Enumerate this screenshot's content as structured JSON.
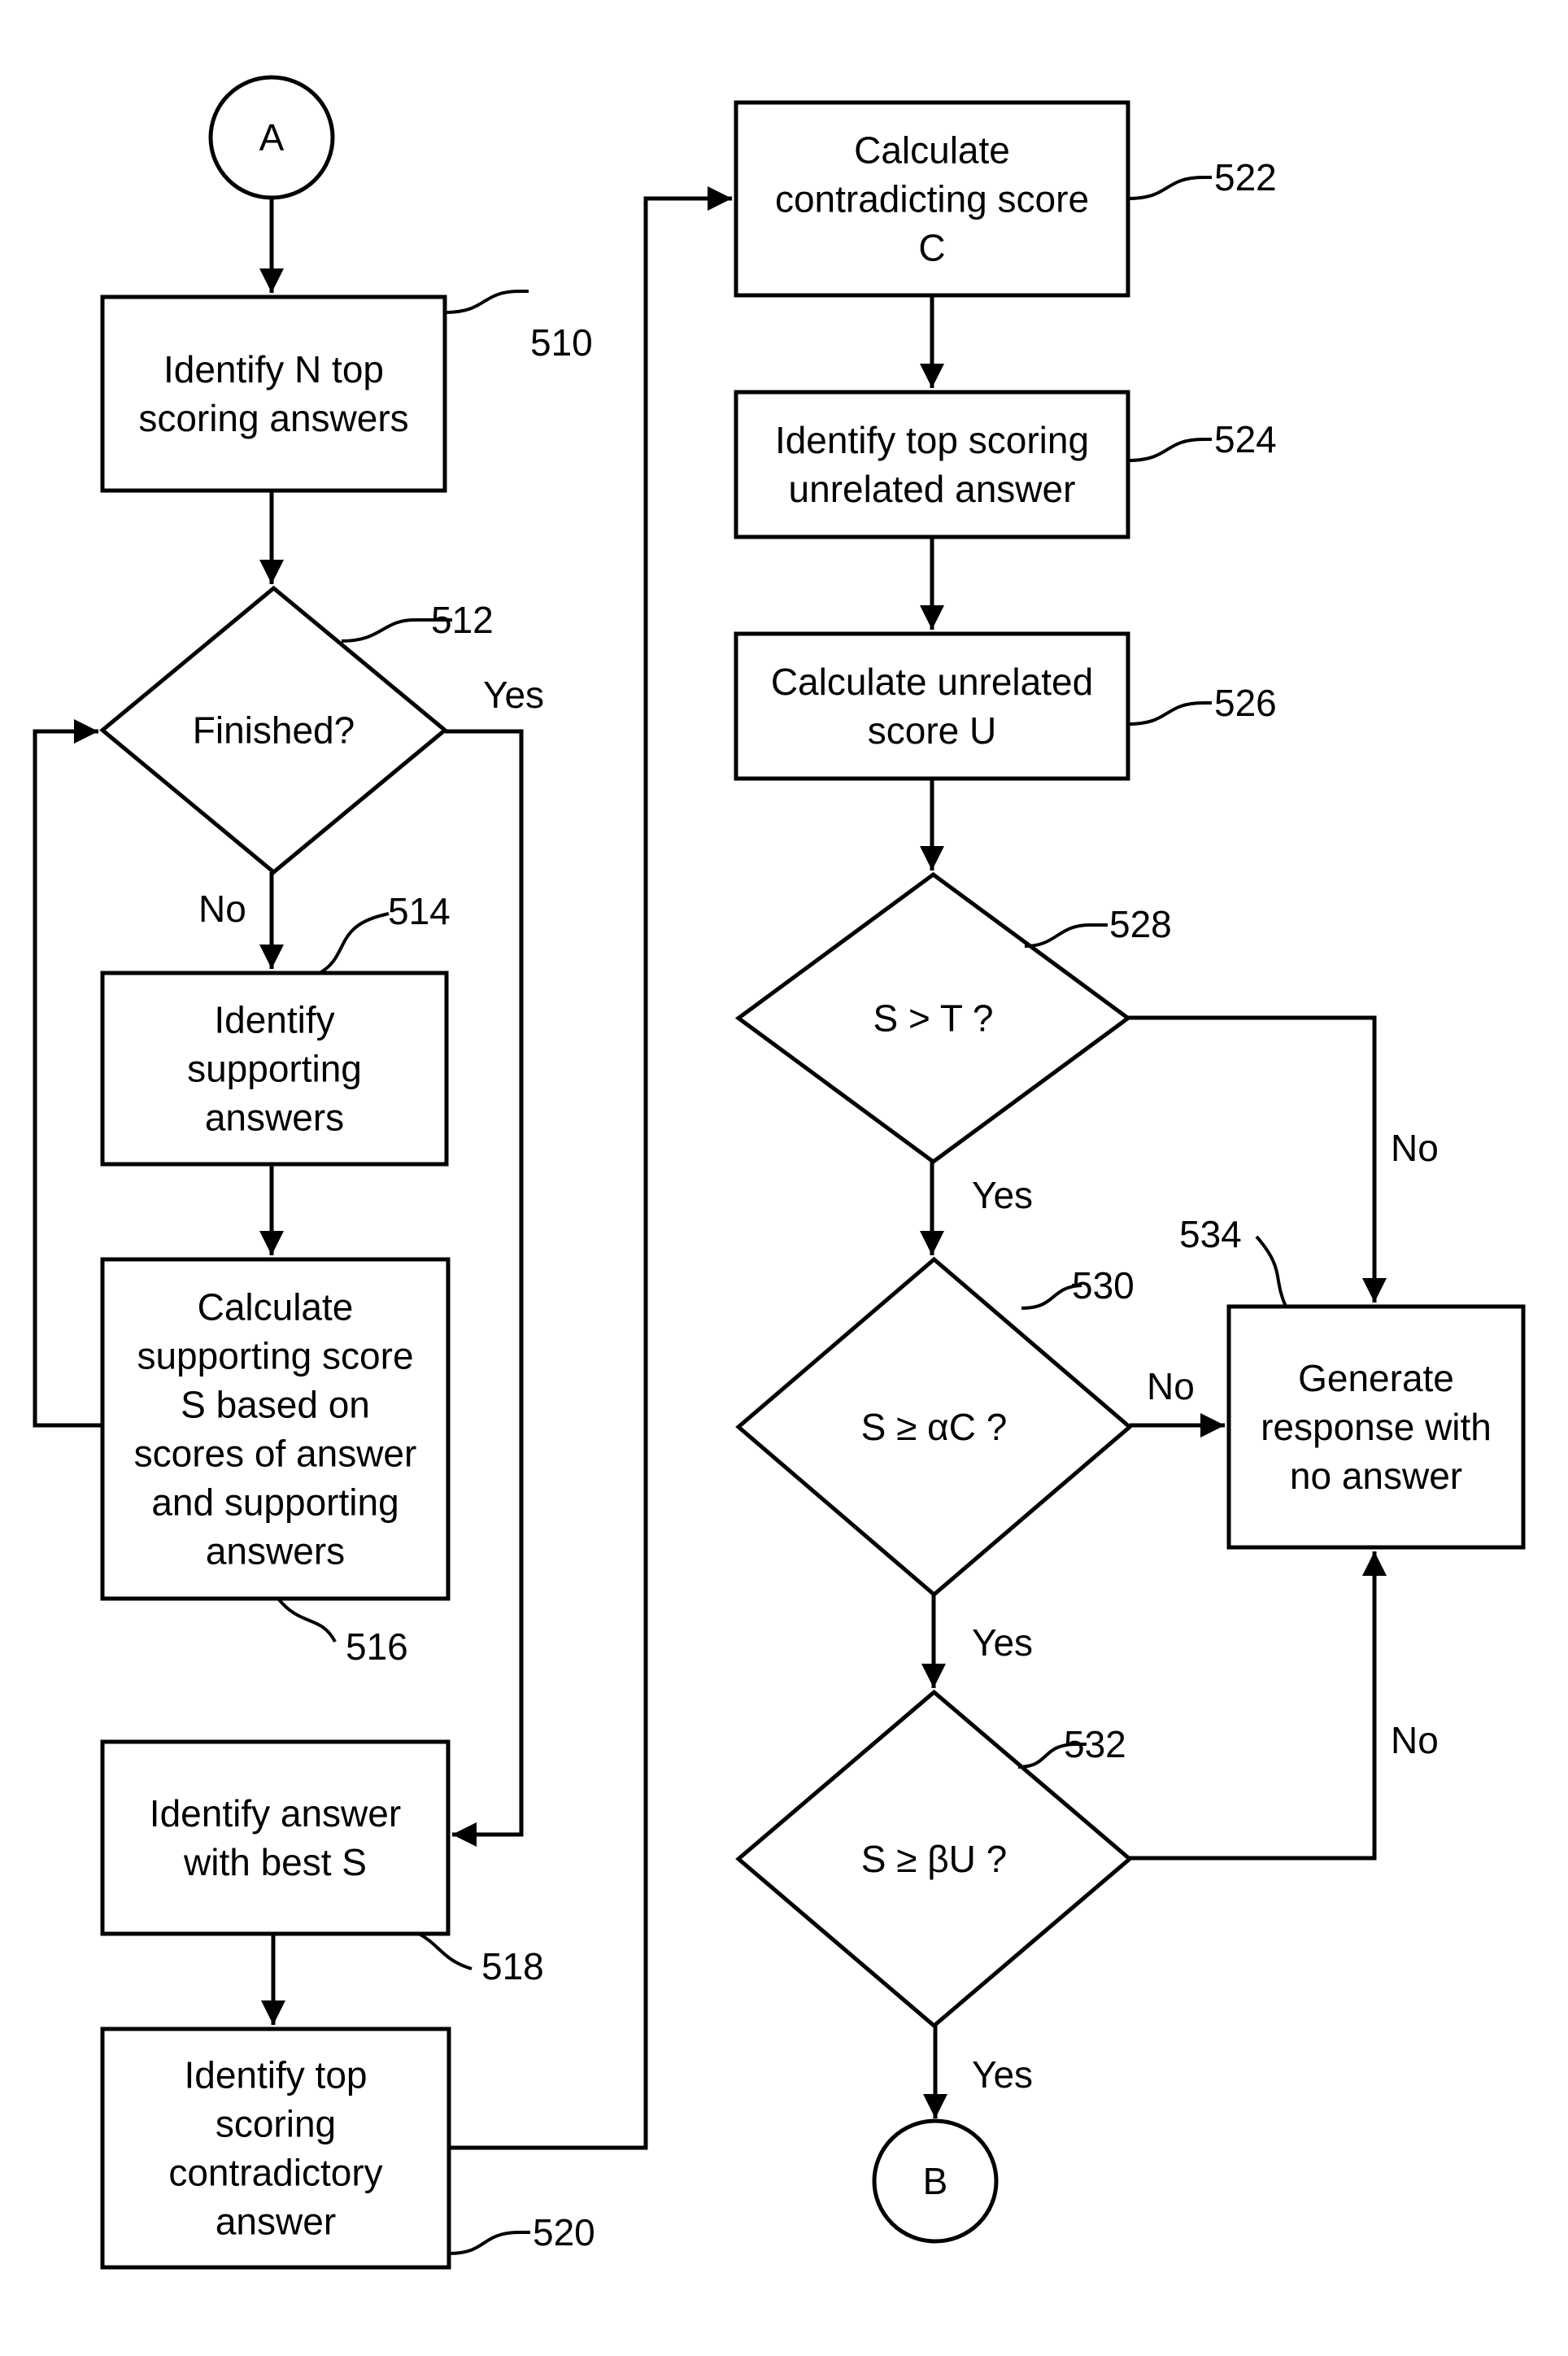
{
  "diagram": {
    "type": "flowchart",
    "connectors": {
      "start": {
        "label": "A"
      },
      "end": {
        "label": "B"
      }
    },
    "nodes": [
      {
        "id": "510",
        "ref": "510",
        "shape": "process",
        "lines": [
          "Identify N top",
          "scoring answers"
        ]
      },
      {
        "id": "512",
        "ref": "512",
        "shape": "decision",
        "lines": [
          "Finished?"
        ]
      },
      {
        "id": "514",
        "ref": "514",
        "shape": "process",
        "lines": [
          "Identify",
          "supporting",
          "answers"
        ]
      },
      {
        "id": "516",
        "ref": "516",
        "shape": "process",
        "lines": [
          "Calculate",
          "supporting score",
          "S based on",
          "scores of answer",
          "and supporting",
          "answers"
        ]
      },
      {
        "id": "518",
        "ref": "518",
        "shape": "process",
        "lines": [
          "Identify answer",
          "with best S"
        ]
      },
      {
        "id": "520",
        "ref": "520",
        "shape": "process",
        "lines": [
          "Identify top",
          "scoring",
          "contradictory",
          "answer"
        ]
      },
      {
        "id": "522",
        "ref": "522",
        "shape": "process",
        "lines": [
          "Calculate",
          "contradicting score",
          "C"
        ]
      },
      {
        "id": "524",
        "ref": "524",
        "shape": "process",
        "lines": [
          "Identify top scoring",
          "unrelated answer"
        ]
      },
      {
        "id": "526",
        "ref": "526",
        "shape": "process",
        "lines": [
          "Calculate unrelated",
          "score U"
        ]
      },
      {
        "id": "528",
        "ref": "528",
        "shape": "decision",
        "lines": [
          "S > T ?"
        ]
      },
      {
        "id": "530",
        "ref": "530",
        "shape": "decision",
        "lines": [
          "S ≥ αC ?"
        ]
      },
      {
        "id": "532",
        "ref": "532",
        "shape": "decision",
        "lines": [
          "S ≥ βU ?"
        ]
      },
      {
        "id": "534",
        "ref": "534",
        "shape": "process",
        "lines": [
          "Generate",
          "response with",
          "no answer"
        ]
      }
    ],
    "edges": [
      {
        "from": "A",
        "to": "510",
        "label": ""
      },
      {
        "from": "510",
        "to": "512",
        "label": ""
      },
      {
        "from": "512",
        "to": "514",
        "label": "No"
      },
      {
        "from": "512",
        "to": "518",
        "label": "Yes"
      },
      {
        "from": "514",
        "to": "516",
        "label": ""
      },
      {
        "from": "516",
        "to": "512",
        "label": ""
      },
      {
        "from": "518",
        "to": "520",
        "label": ""
      },
      {
        "from": "520",
        "to": "522",
        "label": ""
      },
      {
        "from": "522",
        "to": "524",
        "label": ""
      },
      {
        "from": "524",
        "to": "526",
        "label": ""
      },
      {
        "from": "526",
        "to": "528",
        "label": ""
      },
      {
        "from": "528",
        "to": "530",
        "label": "Yes"
      },
      {
        "from": "528",
        "to": "534",
        "label": "No"
      },
      {
        "from": "530",
        "to": "532",
        "label": "Yes"
      },
      {
        "from": "530",
        "to": "534",
        "label": "No"
      },
      {
        "from": "532",
        "to": "B",
        "label": "Yes"
      },
      {
        "from": "532",
        "to": "534",
        "label": "No"
      }
    ],
    "edge_labels": {
      "yes": "Yes",
      "no": "No"
    }
  }
}
